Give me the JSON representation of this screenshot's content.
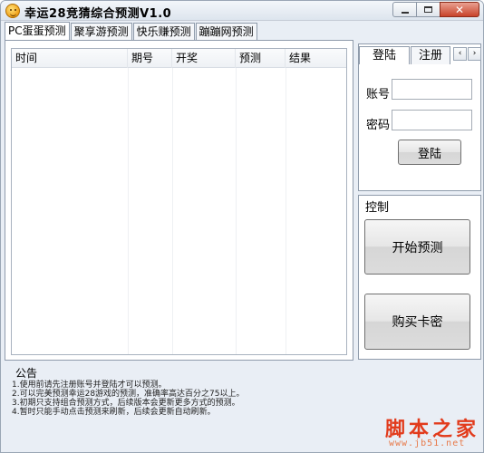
{
  "window": {
    "title": "幸运28竞猜综合预测V1.0",
    "controls": {
      "minimize": "",
      "maximize": "",
      "close": "✕"
    }
  },
  "main_tabs": [
    {
      "label": "PC蛋蛋预测",
      "active": true
    },
    {
      "label": "聚享游预测",
      "active": false
    },
    {
      "label": "快乐赚预测",
      "active": false
    },
    {
      "label": "蹦蹦网预测",
      "active": false
    }
  ],
  "grid": {
    "columns": [
      "时间",
      "期号",
      "开奖",
      "预测",
      "结果"
    ],
    "rows": []
  },
  "bulletin": {
    "label": "公告",
    "lines": [
      "1.使用前请先注册账号并登陆才可以预测。",
      "2.可以完美预测幸运28游戏的预测，准确率高达百分之75以上。",
      "3.初期只支持组合预测方式，后续版本会更新更多方式的预测。",
      "4.暂时只能手动点击预测来刷新，后续会更新自动刷新。"
    ]
  },
  "login": {
    "tabs": [
      {
        "label": "登陆",
        "active": true
      },
      {
        "label": "注册",
        "active": false
      }
    ],
    "scroll_left": "‹",
    "scroll_right": "›",
    "account_label": "账号",
    "account_value": "",
    "password_label": "密码",
    "password_value": "",
    "submit_label": "登陆"
  },
  "control": {
    "label": "控制",
    "start_button": "开始预测",
    "buy_button": "购买卡密"
  },
  "watermark": {
    "main": "脚本之家",
    "sub": "www.jb51.net"
  },
  "colors": {
    "accent": "#e23b1c",
    "window_bg": "#e9eef5",
    "border": "#8f9bab"
  }
}
